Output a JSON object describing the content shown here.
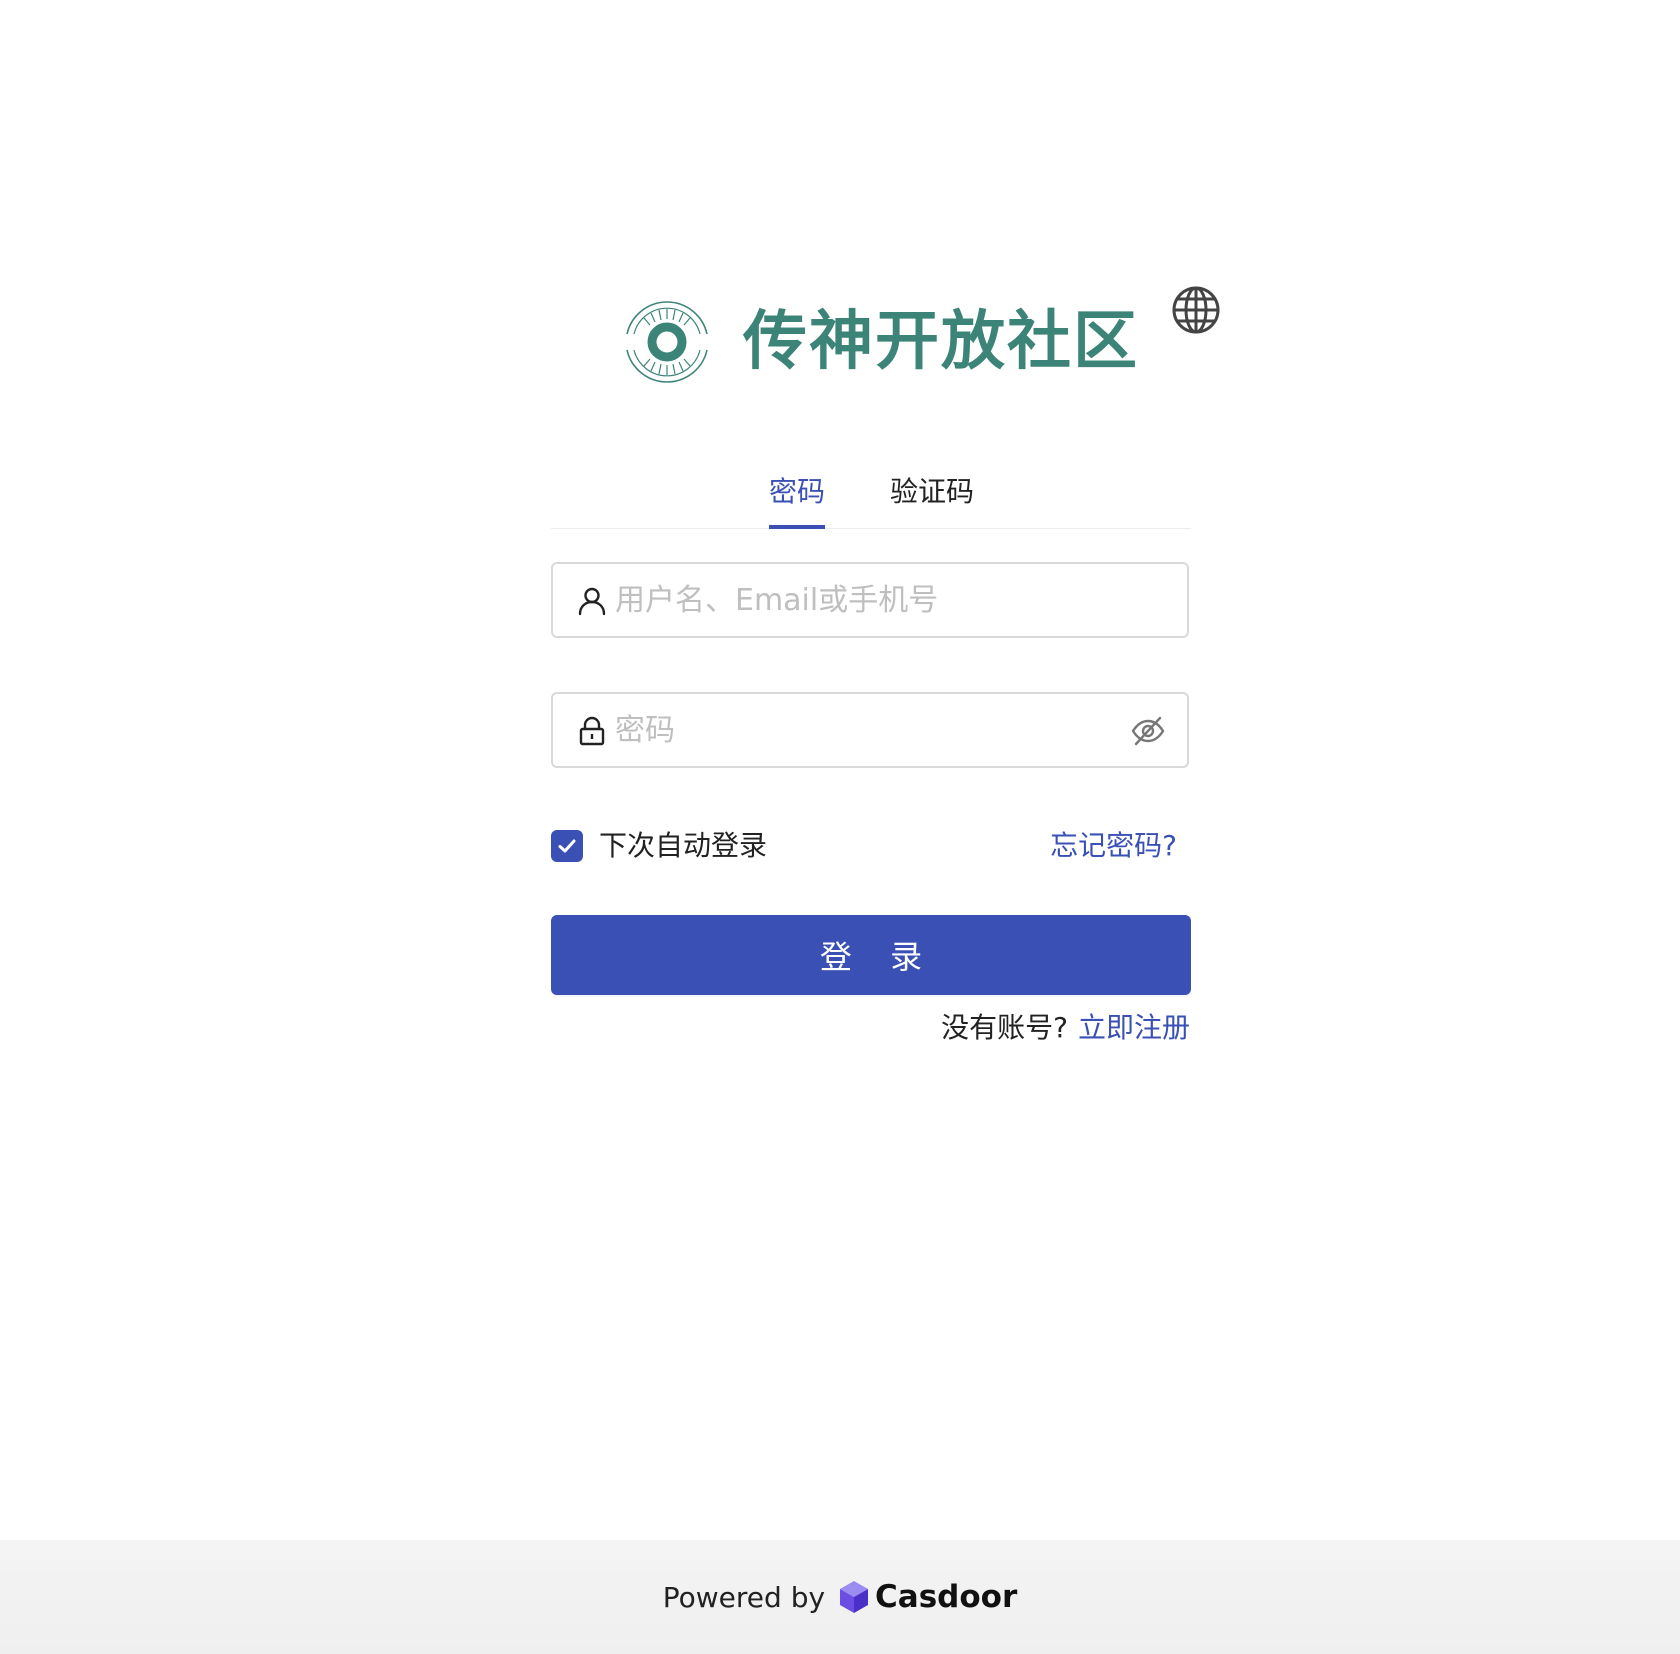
{
  "brand": {
    "name": "传神开放社区",
    "logo_icon": "eye-ring-logo-icon",
    "color": "#3d8478"
  },
  "language_icon": "globe-icon",
  "tabs": [
    {
      "label": "密码",
      "active": true
    },
    {
      "label": "验证码",
      "active": false
    }
  ],
  "form": {
    "username": {
      "placeholder": "用户名、Email或手机号",
      "value": "",
      "icon": "user-icon"
    },
    "password": {
      "placeholder": "密码",
      "value": "",
      "icon": "lock-icon",
      "toggle_icon": "eye-invisible-icon"
    },
    "remember": {
      "label": "下次自动登录",
      "checked": true
    },
    "forgot_label": "忘记密码?",
    "login_label": "登 录",
    "no_account_label": "没有账号?",
    "signup_label": "立即注册"
  },
  "footer": {
    "powered_by": "Powered by",
    "product_name": "Casdoor",
    "product_icon": "casdoor-cube-icon"
  },
  "colors": {
    "primary": "#3a50b5",
    "brand_green": "#3d8478",
    "placeholder": "#bfbfbf",
    "footer_bg": "#f3f3f3"
  }
}
